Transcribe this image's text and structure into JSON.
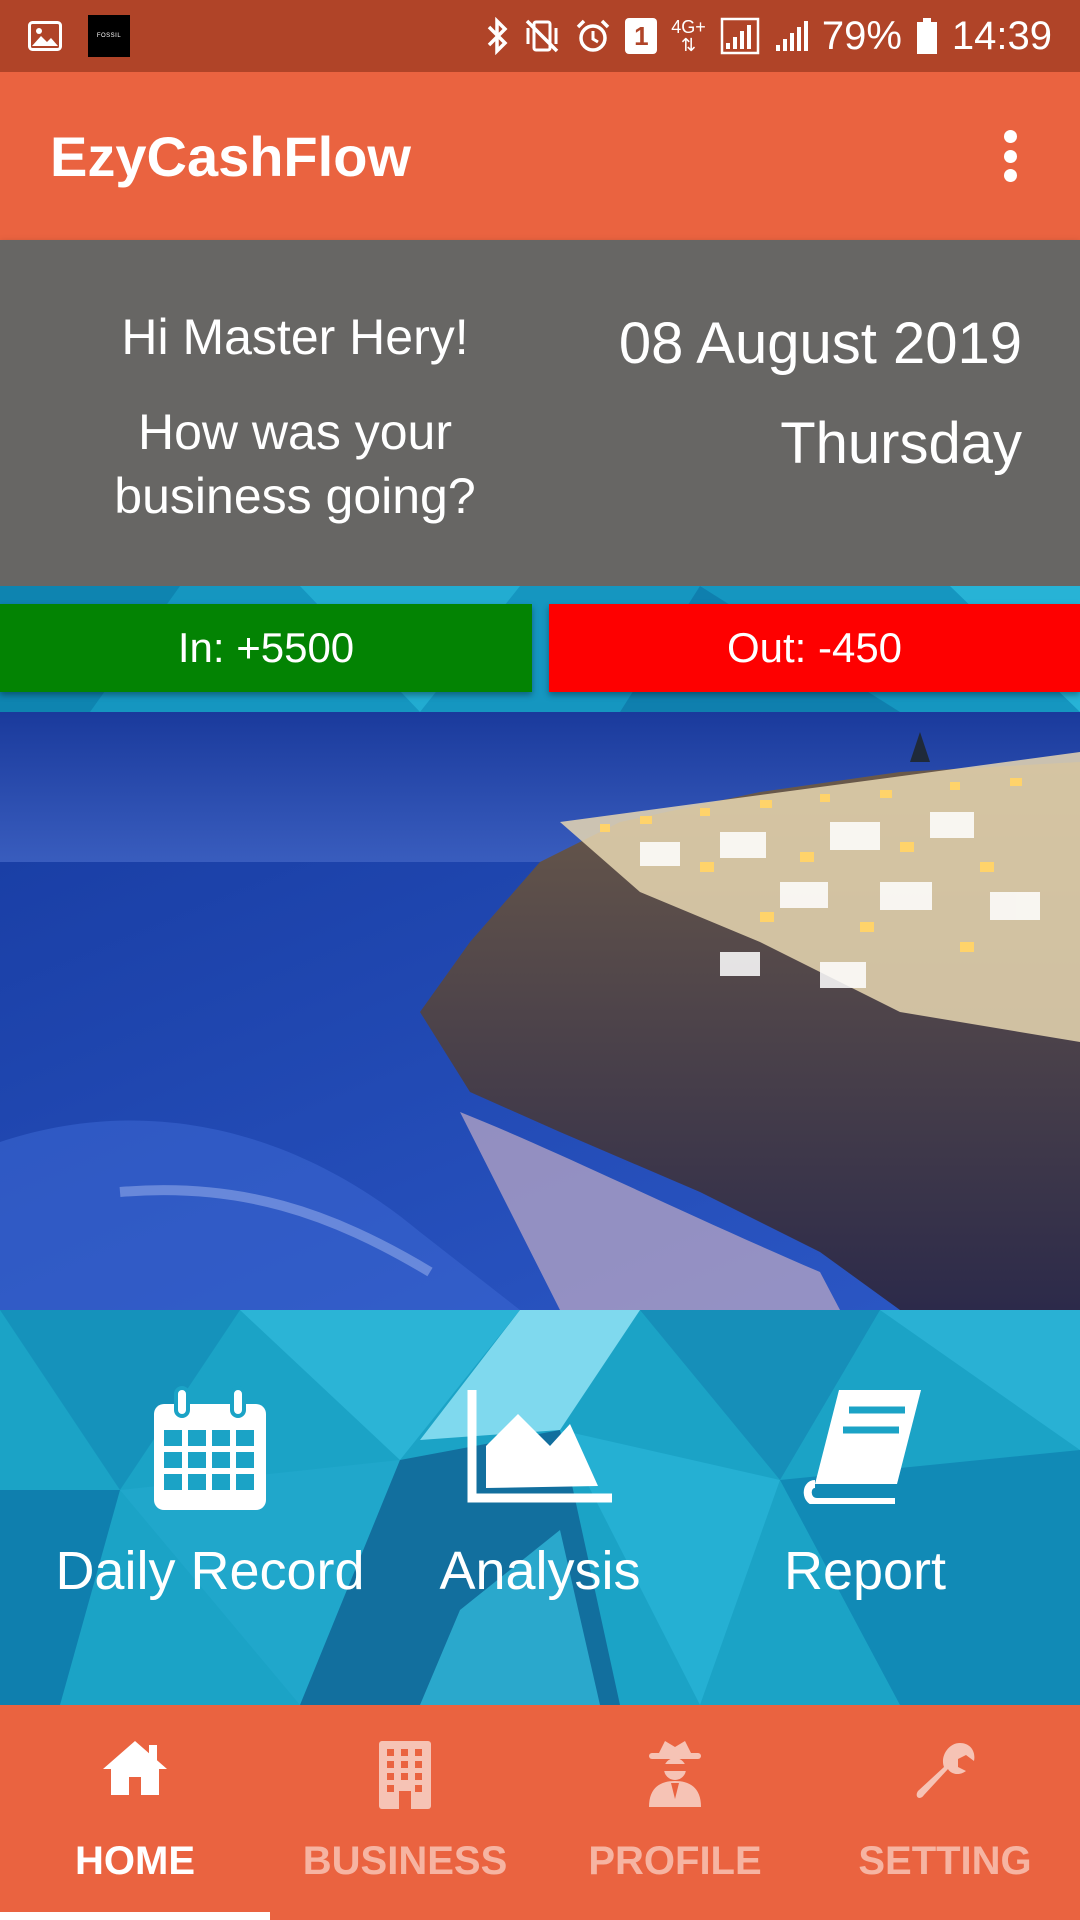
{
  "status_bar": {
    "battery": "79%",
    "time": "14:39",
    "sim_slot": "1",
    "network": "4G+",
    "watch_badge": "FOSSIL",
    "icons": [
      "gallery-icon",
      "fossil-icon",
      "bluetooth-icon",
      "vibrate-mute-icon",
      "alarm-icon",
      "sim-icon",
      "network-4g-icon",
      "signal-icon",
      "signal-2-icon",
      "battery-icon"
    ]
  },
  "app_bar": {
    "title": "EzyCashFlow"
  },
  "greeting": {
    "hello": "Hi Master Hery!",
    "question": "How was your business going?",
    "date": "08 August 2019",
    "weekday": "Thursday"
  },
  "cash": {
    "in_label": "In: +5500",
    "out_label": "Out: -450",
    "in_color": "#038303",
    "out_color": "#fe0000"
  },
  "tiles": [
    {
      "label": "Daily Record",
      "icon": "calendar-icon"
    },
    {
      "label": "Analysis",
      "icon": "area-chart-icon"
    },
    {
      "label": "Report",
      "icon": "book-icon"
    }
  ],
  "bottom_nav": {
    "active": "HOME",
    "items": [
      {
        "label": "HOME",
        "icon": "home-icon"
      },
      {
        "label": "BUSINESS",
        "icon": "building-icon"
      },
      {
        "label": "PROFILE",
        "icon": "spy-icon"
      },
      {
        "label": "SETTING",
        "icon": "wrench-icon"
      }
    ]
  },
  "colors": {
    "status_bar": "#b04428",
    "app_bar": "#ea6340",
    "greeting_bg": "#676664",
    "tiles_bg": "#1ba3c6",
    "nav_inactive_text": "#f6b4a2"
  }
}
